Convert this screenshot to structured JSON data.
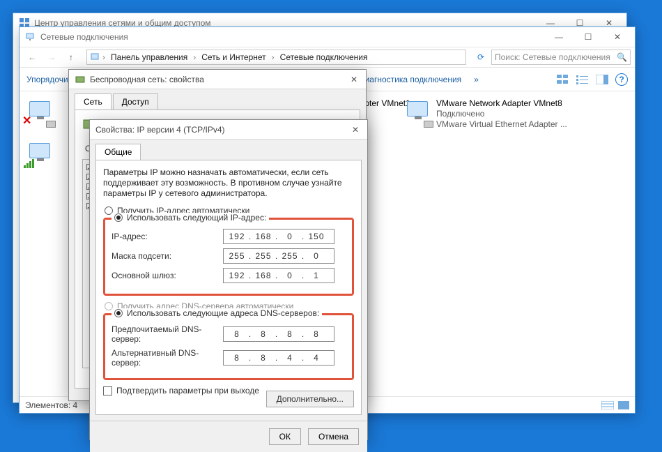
{
  "back_window": {
    "title": "Центр управления сетями и общим доступом"
  },
  "conn_window": {
    "title": "Сетевые подключения",
    "crumbs": [
      "Панель управления",
      "Сеть и Интернет",
      "Сетевые подключения"
    ],
    "search_placeholder": "Поиск: Сетевые подключения",
    "toolbar": {
      "organize": "Упорядочить",
      "diag": "Диагностика подключения",
      "more": "»"
    },
    "adapters": [
      {
        "name": "VMware Network Adapter VMnet1"
      },
      {
        "name": "VMware Network Adapter VMnet8",
        "status": "Подключено",
        "desc": "VMware Virtual Ethernet Adapter ..."
      }
    ],
    "statusbar": "Элементов: 4"
  },
  "wireless_dialog": {
    "title": "Беспроводная сеть: свойства",
    "tabs": {
      "net": "Сеть",
      "access": "Доступ"
    },
    "section": "От"
  },
  "ipv4_dialog": {
    "title": "Свойства: IP версии 4 (TCP/IPv4)",
    "tab": "Общие",
    "description": "Параметры IP можно назначать автоматически, если сеть поддерживает эту возможность. В противном случае узнайте параметры IP у сетевого администратора.",
    "radio_auto_ip": "Получить IP-адрес автоматически",
    "radio_manual_ip": "Использовать следующий IP-адрес:",
    "labels": {
      "ip": "IP-адрес:",
      "mask": "Маска подсети:",
      "gw": "Основной шлюз:"
    },
    "ip": [
      "192",
      "168",
      "0",
      "150"
    ],
    "mask": [
      "255",
      "255",
      "255",
      "0"
    ],
    "gw": [
      "192",
      "168",
      "0",
      "1"
    ],
    "radio_auto_dns": "Получить адрес DNS-сервера автоматически",
    "radio_manual_dns": "Использовать следующие адреса DNS-серверов:",
    "dns_labels": {
      "pref": "Предпочитаемый DNS-сервер:",
      "alt": "Альтернативный DNS-сервер:"
    },
    "dns1": [
      "8",
      "8",
      "8",
      "8"
    ],
    "dns2": [
      "8",
      "8",
      "4",
      "4"
    ],
    "validate": "Подтвердить параметры при выходе",
    "advanced": "Дополнительно...",
    "ok": "ОК",
    "cancel": "Отмена"
  }
}
